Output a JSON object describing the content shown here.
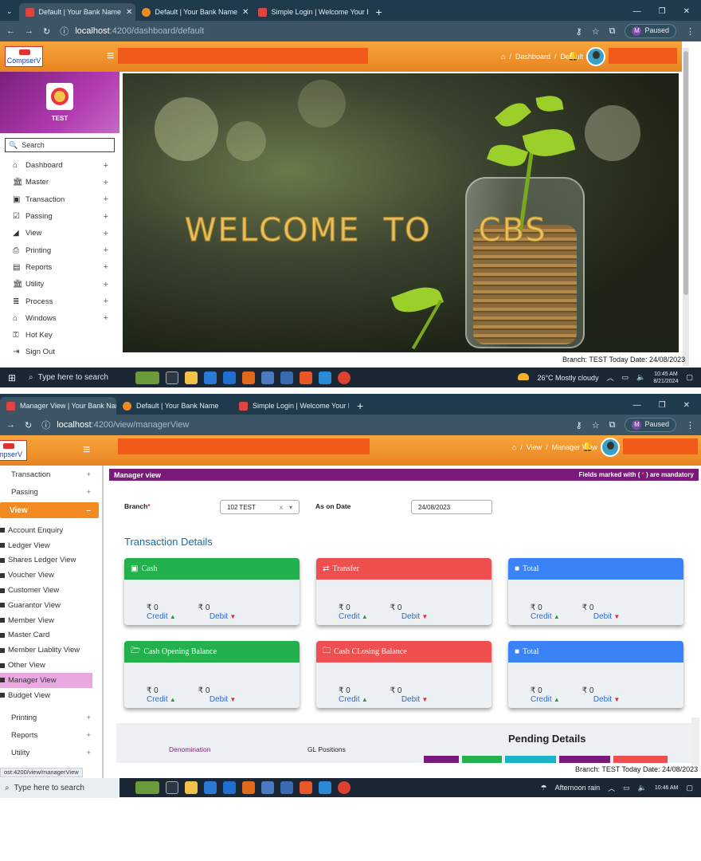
{
  "shot1": {
    "tabs": [
      {
        "label": "Default | Your Bank Name"
      },
      {
        "label": "Default | Your Bank Name"
      },
      {
        "label": "Simple Login | Welcome Your B"
      }
    ],
    "url_host": "localhost",
    "url_path": ":4200/dashboard/default",
    "profile_btn": "Paused",
    "profile_initial": "M",
    "logo_text": "CompserV",
    "breadcrumb": [
      "Dashboard",
      "Default"
    ],
    "profile_name": "TEST",
    "search_placeholder": "Search",
    "menu": [
      {
        "label": "Dashboard",
        "icon": "home-icon",
        "glyph": "⌂",
        "plus": "+"
      },
      {
        "label": "Master",
        "icon": "bank-icon",
        "glyph": "🏛",
        "plus": "+"
      },
      {
        "label": "Transaction",
        "icon": "money-icon",
        "glyph": "▣",
        "plus": "+"
      },
      {
        "label": "Passing",
        "icon": "check-icon",
        "glyph": "☑",
        "plus": "+"
      },
      {
        "label": "View",
        "icon": "eraser-icon",
        "glyph": "◢",
        "plus": "+"
      },
      {
        "label": "Printing",
        "icon": "printer-icon",
        "glyph": "⎙",
        "plus": "+"
      },
      {
        "label": "Reports",
        "icon": "report-icon",
        "glyph": "▤",
        "plus": "+"
      },
      {
        "label": "Utility",
        "icon": "bank-icon",
        "glyph": "🏛",
        "plus": "+"
      },
      {
        "label": "Process",
        "icon": "list-icon",
        "glyph": "≣",
        "plus": "+"
      },
      {
        "label": "Windows",
        "icon": "home-icon",
        "glyph": "⌂",
        "plus": "+"
      },
      {
        "label": "Hot Key",
        "icon": "key-icon",
        "glyph": "⚿",
        "plus": ""
      },
      {
        "label": "Sign Out",
        "icon": "signout-icon",
        "glyph": "⇥",
        "plus": ""
      }
    ],
    "welcome_a": "WELCOME",
    "welcome_b": "TO",
    "welcome_c": "CBS",
    "status": "Branch: TEST Today Date: 24/08/2023",
    "taskbar": {
      "search": "Type here to search",
      "weather": "26°C  Mostly cloudy",
      "time": "10:45 AM",
      "date": "8/21/2024"
    }
  },
  "shot2": {
    "tabs": [
      {
        "label": "Manager View | Your Bank Nam"
      },
      {
        "label": "Default | Your Bank Name"
      },
      {
        "label": "Simple Login | Welcome Your B"
      }
    ],
    "url_host": "localhost",
    "url_path": ":4200/view/managerView",
    "profile_btn": "Paused",
    "profile_initial": "M",
    "logo_text": "ompserV",
    "breadcrumb": [
      "View",
      "Manager View"
    ],
    "menu_top": [
      {
        "label": "Transaction",
        "plus": "+"
      },
      {
        "label": "Passing",
        "plus": "+"
      }
    ],
    "view_label": "View",
    "view_minus": "–",
    "view_items": [
      "Account Enquiry",
      "Ledger View",
      "Shares Ledger View",
      "Voucher View",
      "Customer View",
      "Guarantor View",
      "Member View",
      "Master Card",
      "Member Liablity View",
      "Other View",
      "Manager View",
      "Budget View"
    ],
    "menu_bottom": [
      {
        "label": "Printing",
        "plus": "+"
      },
      {
        "label": "Reports",
        "plus": "+"
      },
      {
        "label": "Utility",
        "plus": "+"
      }
    ],
    "page_title": "Manager view",
    "mandatory_pre": "Fields marked with (",
    "mandatory_star": " * ",
    "mandatory_post": ") are mandatory",
    "branch_label": "Branch",
    "branch_value": "102 TEST",
    "asondate_label": "As on Date",
    "asondate_value": "24/08/2023",
    "section_title": "Transaction Details",
    "cards": [
      {
        "title": "Cash",
        "icon": "money-icon",
        "glyph": "▣",
        "color": "#22b14c",
        "credit_val": "₹ 0",
        "debit_val": "₹ 0"
      },
      {
        "title": "Transfer",
        "icon": "transfer-icon",
        "glyph": "⇄",
        "color": "#f04f4f",
        "credit_val": "₹ 0",
        "debit_val": "₹ 0"
      },
      {
        "title": "Total",
        "icon": "square-icon",
        "glyph": "■",
        "color": "#3a82f6",
        "credit_val": "₹ 0",
        "debit_val": "₹ 0"
      },
      {
        "title": "Cash Opening Balance",
        "icon": "folder-open-icon",
        "glyph": "🗁",
        "color": "#22b14c",
        "credit_val": "₹ 0",
        "debit_val": "₹ 0"
      },
      {
        "title": "Cash CLosing Balance",
        "icon": "folder-icon",
        "glyph": "🗀",
        "color": "#f04f4f",
        "credit_val": "₹ 0",
        "debit_val": "₹ 0"
      },
      {
        "title": "Total",
        "icon": "square-icon",
        "glyph": "■",
        "color": "#3a82f6",
        "credit_val": "₹ 0",
        "debit_val": "₹ 0"
      }
    ],
    "credit_label": "Credit",
    "debit_label": "Debit",
    "pending_title": "Pending Details",
    "denomination_label": "Denomination",
    "gl_label": "GL Positions",
    "status": "Branch: TEST Today Date: 24/08/2023",
    "url_hint": "ost:4200/view/managerView",
    "taskbar": {
      "search": "Type here to search",
      "weather": "Afternoon rain",
      "time": "10:46 AM"
    }
  },
  "colors": {
    "orange": "#f28c22",
    "purple": "#7a1a7a",
    "green": "#22b14c",
    "red": "#f04f4f",
    "blue": "#3a82f6"
  }
}
